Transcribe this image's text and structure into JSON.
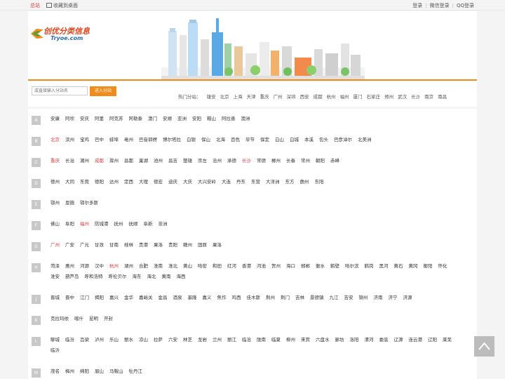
{
  "topbar": {
    "main_site": "总站",
    "favorite": "收藏到桌面",
    "login": "登录",
    "wechat_login": "微信登录",
    "qq_login": "QQ登录"
  },
  "logo": {
    "cn": "创优分类信息",
    "en": "Tryoe.com"
  },
  "search": {
    "placeholder": "或直接输入分站名",
    "button": "进入分站"
  },
  "hot": {
    "label": "热门分站：",
    "cities": [
      "雄安",
      "北京",
      "上海",
      "天津",
      "重庆",
      "广州",
      "深圳",
      "西安",
      "成都",
      "杭州",
      "福州",
      "厦门",
      "石家庄",
      "郑州",
      "武汉",
      "长沙",
      "南京",
      "南昌"
    ]
  },
  "rows": [
    {
      "letter": "A",
      "cities": [
        {
          "name": "安康"
        },
        {
          "name": "阿坝"
        },
        {
          "name": "安庆"
        },
        {
          "name": "阿里"
        },
        {
          "name": "阿克苏"
        },
        {
          "name": "阿勒泰"
        },
        {
          "name": "澳门"
        },
        {
          "name": "安顺"
        },
        {
          "name": "亚洲"
        },
        {
          "name": "安阳"
        },
        {
          "name": "鞍山"
        },
        {
          "name": "阿拉善"
        },
        {
          "name": "澳洲"
        }
      ]
    },
    {
      "letter": "B",
      "cities": [
        {
          "name": "北京",
          "hot": true
        },
        {
          "name": "滨州"
        },
        {
          "name": "宝鸡"
        },
        {
          "name": "巴中"
        },
        {
          "name": "蚌埠"
        },
        {
          "name": "亳州"
        },
        {
          "name": "巴音郭楞"
        },
        {
          "name": "博尔塔拉"
        },
        {
          "name": "白银"
        },
        {
          "name": "保山"
        },
        {
          "name": "北海"
        },
        {
          "name": "百色"
        },
        {
          "name": "毕节"
        },
        {
          "name": "保定"
        },
        {
          "name": "白山"
        },
        {
          "name": "白城"
        },
        {
          "name": "本溪"
        },
        {
          "name": "包头"
        },
        {
          "name": "巴彦淖尔"
        },
        {
          "name": "北美洲"
        }
      ]
    },
    {
      "letter": "C",
      "cities": [
        {
          "name": "重庆",
          "hot": true
        },
        {
          "name": "长治"
        },
        {
          "name": "潮州"
        },
        {
          "name": "成都",
          "hot": true
        },
        {
          "name": "滁州"
        },
        {
          "name": "昌都"
        },
        {
          "name": "巢湖"
        },
        {
          "name": "池州"
        },
        {
          "name": "昌吉"
        },
        {
          "name": "楚雄"
        },
        {
          "name": "崇左"
        },
        {
          "name": "沧州"
        },
        {
          "name": "承德"
        },
        {
          "name": "长沙",
          "hot": true
        },
        {
          "name": "常德"
        },
        {
          "name": "郴州"
        },
        {
          "name": "长春"
        },
        {
          "name": "常州"
        },
        {
          "name": "朝阳"
        },
        {
          "name": "赤峰"
        }
      ]
    },
    {
      "letter": "D",
      "cities": [
        {
          "name": "德州"
        },
        {
          "name": "大同"
        },
        {
          "name": "东莞"
        },
        {
          "name": "德阳"
        },
        {
          "name": "达州"
        },
        {
          "name": "定西"
        },
        {
          "name": "大理"
        },
        {
          "name": "德宏"
        },
        {
          "name": "迪庆"
        },
        {
          "name": "大庆"
        },
        {
          "name": "大兴安岭"
        },
        {
          "name": "大连"
        },
        {
          "name": "丹东"
        },
        {
          "name": "东营"
        },
        {
          "name": "大洋洲"
        },
        {
          "name": "东方"
        },
        {
          "name": "儋州"
        },
        {
          "name": "东阳"
        }
      ]
    },
    {
      "letter": "E",
      "cities": [
        {
          "name": "鄂州"
        },
        {
          "name": "恩施"
        },
        {
          "name": "鄂尔多斯"
        }
      ]
    },
    {
      "letter": "F",
      "cities": [
        {
          "name": "佛山"
        },
        {
          "name": "阜阳"
        },
        {
          "name": "福州",
          "hot": true
        },
        {
          "name": "防城港"
        },
        {
          "name": "抚州"
        },
        {
          "name": "抚顺"
        },
        {
          "name": "阜新"
        },
        {
          "name": "非洲"
        }
      ]
    },
    {
      "letter": "G",
      "cities": [
        {
          "name": "广州",
          "hot": true
        },
        {
          "name": "广安"
        },
        {
          "name": "广元"
        },
        {
          "name": "甘孜"
        },
        {
          "name": "甘南"
        },
        {
          "name": "桂林"
        },
        {
          "name": "贵港"
        },
        {
          "name": "果洛"
        },
        {
          "name": "贵阳"
        },
        {
          "name": "赣州"
        },
        {
          "name": "固原"
        },
        {
          "name": "果洛"
        }
      ]
    },
    {
      "letter": "H",
      "cities": [
        {
          "name": "菏泽"
        },
        {
          "name": "惠州"
        },
        {
          "name": "河源"
        },
        {
          "name": "汉中"
        },
        {
          "name": "杭州",
          "hot": true
        },
        {
          "name": "湖州"
        },
        {
          "name": "合肥"
        },
        {
          "name": "淮南"
        },
        {
          "name": "淮北"
        },
        {
          "name": "黄山"
        },
        {
          "name": "哈密"
        },
        {
          "name": "和田"
        },
        {
          "name": "红河"
        },
        {
          "name": "香港"
        },
        {
          "name": "河池"
        },
        {
          "name": "贺州"
        },
        {
          "name": "海口"
        },
        {
          "name": "邯郸"
        },
        {
          "name": "衡水"
        },
        {
          "name": "鹤壁"
        },
        {
          "name": "哈尔滨"
        },
        {
          "name": "鹤岗"
        },
        {
          "name": "黑河"
        },
        {
          "name": "黄石"
        },
        {
          "name": "黄冈"
        },
        {
          "name": "衡阳"
        },
        {
          "name": "怀化"
        },
        {
          "name": "淮安"
        },
        {
          "name": "葫芦岛"
        },
        {
          "name": "呼和浩特"
        },
        {
          "name": "呼伦贝尔"
        },
        {
          "name": "海东"
        },
        {
          "name": "海北"
        },
        {
          "name": "黄南"
        },
        {
          "name": "海西"
        }
      ]
    },
    {
      "letter": "J",
      "cities": [
        {
          "name": "晋城"
        },
        {
          "name": "晋中"
        },
        {
          "name": "江门"
        },
        {
          "name": "揭阳"
        },
        {
          "name": "嘉兴"
        },
        {
          "name": "金华"
        },
        {
          "name": "嘉峪关"
        },
        {
          "name": "金昌"
        },
        {
          "name": "酒泉"
        },
        {
          "name": "基隆"
        },
        {
          "name": "嘉义"
        },
        {
          "name": "焦作"
        },
        {
          "name": "鸡西"
        },
        {
          "name": "佳木斯"
        },
        {
          "name": "荆州"
        },
        {
          "name": "荆门"
        },
        {
          "name": "吉林"
        },
        {
          "name": "景德镇"
        },
        {
          "name": "九江"
        },
        {
          "name": "吉安"
        },
        {
          "name": "锦州"
        },
        {
          "name": "济南"
        },
        {
          "name": "济宁"
        },
        {
          "name": "济源"
        }
      ]
    },
    {
      "letter": "K",
      "cities": [
        {
          "name": "克拉玛依"
        },
        {
          "name": "喀什"
        },
        {
          "name": "昆明"
        },
        {
          "name": "开封"
        }
      ]
    },
    {
      "letter": "L",
      "cities": [
        {
          "name": "聊城"
        },
        {
          "name": "临汾"
        },
        {
          "name": "吕梁"
        },
        {
          "name": "泸州"
        },
        {
          "name": "乐山"
        },
        {
          "name": "丽水"
        },
        {
          "name": "凉山"
        },
        {
          "name": "拉萨"
        },
        {
          "name": "六安"
        },
        {
          "name": "林芝"
        },
        {
          "name": "龙岩"
        },
        {
          "name": "兰州"
        },
        {
          "name": "丽江"
        },
        {
          "name": "临沧"
        },
        {
          "name": "陇南"
        },
        {
          "name": "临夏"
        },
        {
          "name": "柳州"
        },
        {
          "name": "来宾"
        },
        {
          "name": "六盘水"
        },
        {
          "name": "廊坊"
        },
        {
          "name": "洛阳"
        },
        {
          "name": "漯河"
        },
        {
          "name": "娄底"
        },
        {
          "name": "辽源"
        },
        {
          "name": "连云港"
        },
        {
          "name": "辽阳"
        },
        {
          "name": "莱芜"
        },
        {
          "name": "临沂"
        }
      ]
    },
    {
      "letter": "M",
      "cities": [
        {
          "name": "茂名"
        },
        {
          "name": "梅州"
        },
        {
          "name": "绵阳"
        },
        {
          "name": "眉山"
        },
        {
          "name": "马鞍山"
        },
        {
          "name": "牡丹江"
        }
      ]
    }
  ]
}
